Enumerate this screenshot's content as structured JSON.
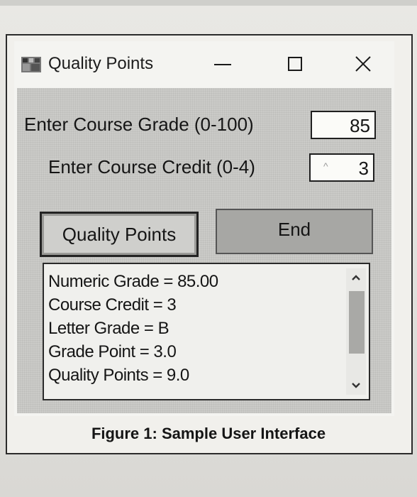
{
  "window": {
    "title": "Quality Points",
    "controls": {
      "minimize_icon": "minimize-icon",
      "maximize_icon": "maximize-icon",
      "close_icon": "close-icon"
    }
  },
  "form": {
    "grade_label": "Enter Course Grade (0-100)",
    "grade_value": "85",
    "credit_label": "Enter Course Credit (0-4)",
    "credit_value": "3",
    "credit_marker": "^"
  },
  "buttons": {
    "quality_points": "Quality Points",
    "end": "End"
  },
  "output": {
    "lines": [
      "Numeric Grade = 85.00",
      "Course Credit = 3",
      "Letter Grade = B",
      "Grade Point = 3.0",
      "Quality Points = 9.0"
    ]
  },
  "caption": "Figure 1: Sample User Interface",
  "colors": {
    "end_button_bg": "#a7a7a4",
    "scroll_thumb": "#a9a9a6"
  }
}
